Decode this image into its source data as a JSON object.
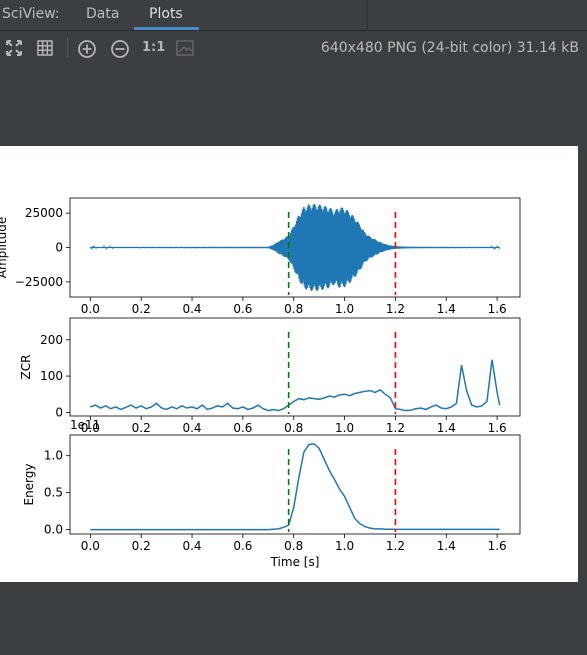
{
  "tabs": {
    "prefix": "SciView:",
    "items": [
      {
        "label": "Data",
        "active": false
      },
      {
        "label": "Plots",
        "active": true
      }
    ]
  },
  "toolbar": {
    "icons": [
      "fit-to-window-icon",
      "grid-icon",
      "zoom-in-icon",
      "zoom-out-icon",
      "actual-size-icon",
      "background-icon"
    ],
    "actual_size_label": "1:1",
    "image_info": "640x480 PNG (24-bit color) 31.14 kB"
  },
  "colors": {
    "background": "#3c3f41",
    "tab_accent": "#4a88c7",
    "series": "#1f77b4",
    "onset_line": "#008000",
    "offset_line": "#ff0000"
  },
  "chart_data": [
    {
      "type": "line",
      "ylabel": "Amplitude",
      "xlim": [
        -0.08,
        1.69
      ],
      "ylim": [
        -36000,
        36000
      ],
      "xticks": [
        "0.0",
        "0.2",
        "0.4",
        "0.6",
        "0.8",
        "1.0",
        "1.2",
        "1.4",
        "1.6"
      ],
      "yticks": [
        "25000",
        "0",
        "−25000"
      ],
      "ytick_values": [
        25000,
        0,
        -25000
      ],
      "series": [
        {
          "envelope_x": [
            0.0,
            0.7,
            0.72,
            0.74,
            0.76,
            0.78,
            0.8,
            0.82,
            0.84,
            0.86,
            0.88,
            0.9,
            0.92,
            0.94,
            0.96,
            0.98,
            1.0,
            1.02,
            1.04,
            1.06,
            1.08,
            1.1,
            1.12,
            1.14,
            1.16,
            1.18,
            1.2,
            1.25,
            1.3,
            1.61
          ],
          "envelope_y": [
            400,
            500,
            2000,
            4500,
            6500,
            9000,
            16000,
            24000,
            30000,
            31500,
            31800,
            31500,
            30500,
            29500,
            27000,
            29500,
            29000,
            26000,
            22000,
            17000,
            11000,
            8000,
            6000,
            4000,
            2500,
            1500,
            1000,
            600,
            500,
            400
          ]
        }
      ],
      "vlines": [
        {
          "x": 0.78,
          "style": "dashed",
          "color": "green"
        },
        {
          "x": 1.2,
          "style": "dashed",
          "color": "red"
        }
      ]
    },
    {
      "type": "line",
      "ylabel": "ZCR",
      "xlim": [
        -0.08,
        1.69
      ],
      "ylim": [
        -10,
        260
      ],
      "xticks": [
        "0.0",
        "0.2",
        "0.4",
        "0.6",
        "0.8",
        "1.0",
        "1.2",
        "1.4",
        "1.6"
      ],
      "yticks": [
        "200",
        "100",
        "0"
      ],
      "ytick_values": [
        200,
        100,
        0
      ],
      "series": [
        {
          "x": [
            0.0,
            0.02,
            0.04,
            0.06,
            0.08,
            0.1,
            0.12,
            0.14,
            0.16,
            0.18,
            0.2,
            0.22,
            0.24,
            0.26,
            0.28,
            0.3,
            0.32,
            0.34,
            0.36,
            0.38,
            0.4,
            0.42,
            0.44,
            0.46,
            0.48,
            0.5,
            0.52,
            0.54,
            0.56,
            0.58,
            0.6,
            0.62,
            0.64,
            0.66,
            0.68,
            0.7,
            0.72,
            0.74,
            0.76,
            0.78,
            0.8,
            0.82,
            0.84,
            0.86,
            0.88,
            0.9,
            0.92,
            0.94,
            0.96,
            0.98,
            1.0,
            1.02,
            1.04,
            1.06,
            1.08,
            1.1,
            1.12,
            1.14,
            1.16,
            1.18,
            1.2,
            1.22,
            1.24,
            1.26,
            1.28,
            1.3,
            1.32,
            1.34,
            1.36,
            1.38,
            1.4,
            1.42,
            1.44,
            1.46,
            1.48,
            1.5,
            1.52,
            1.54,
            1.56,
            1.58,
            1.6,
            1.61
          ],
          "y": [
            15,
            20,
            12,
            18,
            10,
            15,
            8,
            14,
            20,
            12,
            18,
            10,
            15,
            25,
            12,
            8,
            15,
            10,
            18,
            12,
            15,
            10,
            20,
            8,
            12,
            18,
            15,
            25,
            12,
            10,
            15,
            8,
            12,
            20,
            10,
            5,
            8,
            5,
            10,
            20,
            30,
            38,
            35,
            40,
            38,
            36,
            40,
            45,
            42,
            48,
            50,
            46,
            52,
            55,
            58,
            60,
            55,
            62,
            50,
            40,
            10,
            8,
            5,
            6,
            10,
            12,
            8,
            15,
            20,
            12,
            10,
            15,
            25,
            130,
            60,
            20,
            15,
            18,
            30,
            145,
            55,
            20
          ],
          "color": "#1f77b4"
        }
      ],
      "vlines": [
        {
          "x": 0.78,
          "style": "dashed",
          "color": "green"
        },
        {
          "x": 1.2,
          "style": "dashed",
          "color": "red"
        }
      ]
    },
    {
      "type": "line",
      "ylabel": "Energy",
      "xlabel": "Time [s]",
      "offset_text": "1e11",
      "xlim": [
        -0.08,
        1.69
      ],
      "ylim": [
        -0.06,
        1.28
      ],
      "xticks": [
        "0.0",
        "0.2",
        "0.4",
        "0.6",
        "0.8",
        "1.0",
        "1.2",
        "1.4",
        "1.6"
      ],
      "yticks": [
        "1.0",
        "0.5",
        "0.0"
      ],
      "ytick_values": [
        1.0,
        0.5,
        0.0
      ],
      "series": [
        {
          "x": [
            0.0,
            0.7,
            0.74,
            0.76,
            0.78,
            0.8,
            0.82,
            0.84,
            0.86,
            0.88,
            0.9,
            0.92,
            0.94,
            0.96,
            0.98,
            1.0,
            1.02,
            1.04,
            1.06,
            1.08,
            1.1,
            1.12,
            1.14,
            1.16,
            1.18,
            1.2,
            1.3,
            1.61
          ],
          "y": [
            0,
            0,
            0.01,
            0.03,
            0.06,
            0.3,
            0.7,
            1.05,
            1.15,
            1.16,
            1.1,
            0.95,
            0.8,
            0.68,
            0.55,
            0.45,
            0.3,
            0.15,
            0.08,
            0.04,
            0.02,
            0.01,
            0.01,
            0.005,
            0.005,
            0.003,
            0.002,
            0.002
          ],
          "color": "#1f77b4"
        }
      ],
      "vlines": [
        {
          "x": 0.78,
          "style": "dashed",
          "color": "green"
        },
        {
          "x": 1.2,
          "style": "dashed",
          "color": "red"
        }
      ]
    }
  ]
}
